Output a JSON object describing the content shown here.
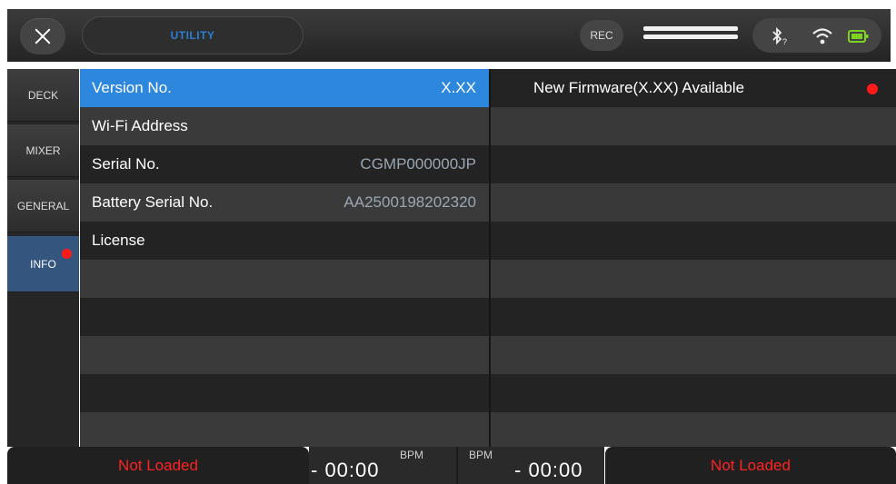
{
  "header": {
    "title": "UTILITY",
    "rec_label": "REC",
    "bluetooth_suffix": "?",
    "icons": [
      "close-icon",
      "recording-level-meter",
      "bluetooth-icon",
      "wifi-icon",
      "battery-icon"
    ]
  },
  "sidebar": {
    "tabs": [
      {
        "label": "DECK"
      },
      {
        "label": "MIXER"
      },
      {
        "label": "GENERAL"
      },
      {
        "label": "INFO",
        "active": true,
        "notification": true
      }
    ]
  },
  "info_list": {
    "rows": [
      {
        "label": "Version No.",
        "value": "X.XX",
        "selected": true
      },
      {
        "label": "Wi-Fi Address",
        "value": ""
      },
      {
        "label": "Serial No.",
        "value": "CGMP000000JP"
      },
      {
        "label": "Battery Serial No.",
        "value": "AA2500198202320"
      },
      {
        "label": "License",
        "value": ""
      }
    ]
  },
  "firmware_panel": {
    "message": "New Firmware(X.XX) Available",
    "indicator": "red-dot"
  },
  "footer": {
    "left_deck": {
      "status": "Not Loaded",
      "bpm_label": "BPM",
      "time": "- 00:00"
    },
    "right_deck": {
      "status": "Not Loaded",
      "bpm_label": "BPM",
      "time": "- 00:00"
    }
  },
  "colors": {
    "accent": "#2d87dd",
    "title_blue": "#2a7fd4",
    "alert_red": "#ff1a1a",
    "not_loaded_red": "#ff2222",
    "battery_green": "#7ed321"
  }
}
